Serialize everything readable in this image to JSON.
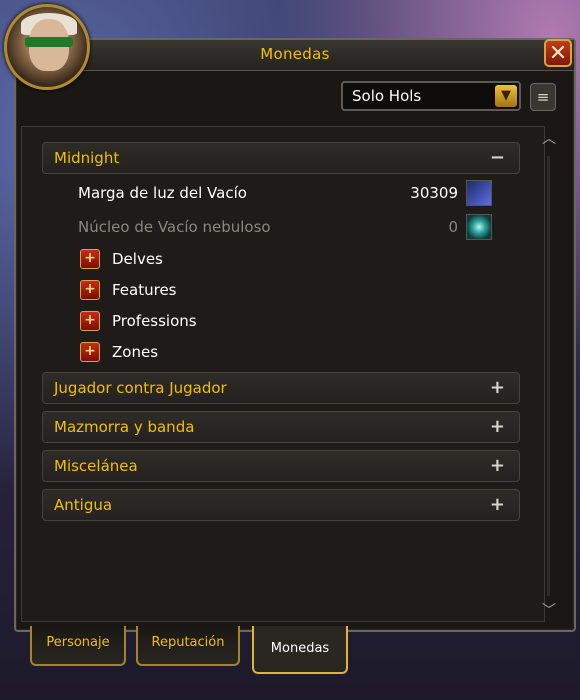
{
  "window": {
    "title": "Monedas",
    "close_icon": "close-icon"
  },
  "filter": {
    "selected": "Solo Hols",
    "arrow_icon": "chevron-down-icon",
    "side_button_icon": "scroll-icon"
  },
  "categories": [
    {
      "label": "Midnight",
      "toggle": "−",
      "expanded": true
    },
    {
      "label": "Jugador contra Jugador",
      "toggle": "+",
      "expanded": false
    },
    {
      "label": "Mazmorra y banda",
      "toggle": "+",
      "expanded": false
    },
    {
      "label": "Miscelánea",
      "toggle": "+",
      "expanded": false
    },
    {
      "label": "Antigua",
      "toggle": "+",
      "expanded": false
    }
  ],
  "currencies": [
    {
      "name": "Marga de luz del Vacío",
      "amount": "30309",
      "icon": "void-crystal-icon"
    },
    {
      "name": "Núcleo de Vacío nebuloso",
      "amount": "0",
      "icon": "void-core-icon"
    }
  ],
  "subcategories": [
    {
      "label": "Delves",
      "toggle": "+"
    },
    {
      "label": "Features",
      "toggle": "+"
    },
    {
      "label": "Professions",
      "toggle": "+"
    },
    {
      "label": "Zones",
      "toggle": "+"
    }
  ],
  "tabs": [
    {
      "label": "Personaje",
      "active": false
    },
    {
      "label": "Reputación",
      "active": false
    },
    {
      "label": "Monedas",
      "active": true
    }
  ],
  "colors": {
    "gold": "#f0c000",
    "white": "#ffffff",
    "dim": "#8a8680"
  }
}
